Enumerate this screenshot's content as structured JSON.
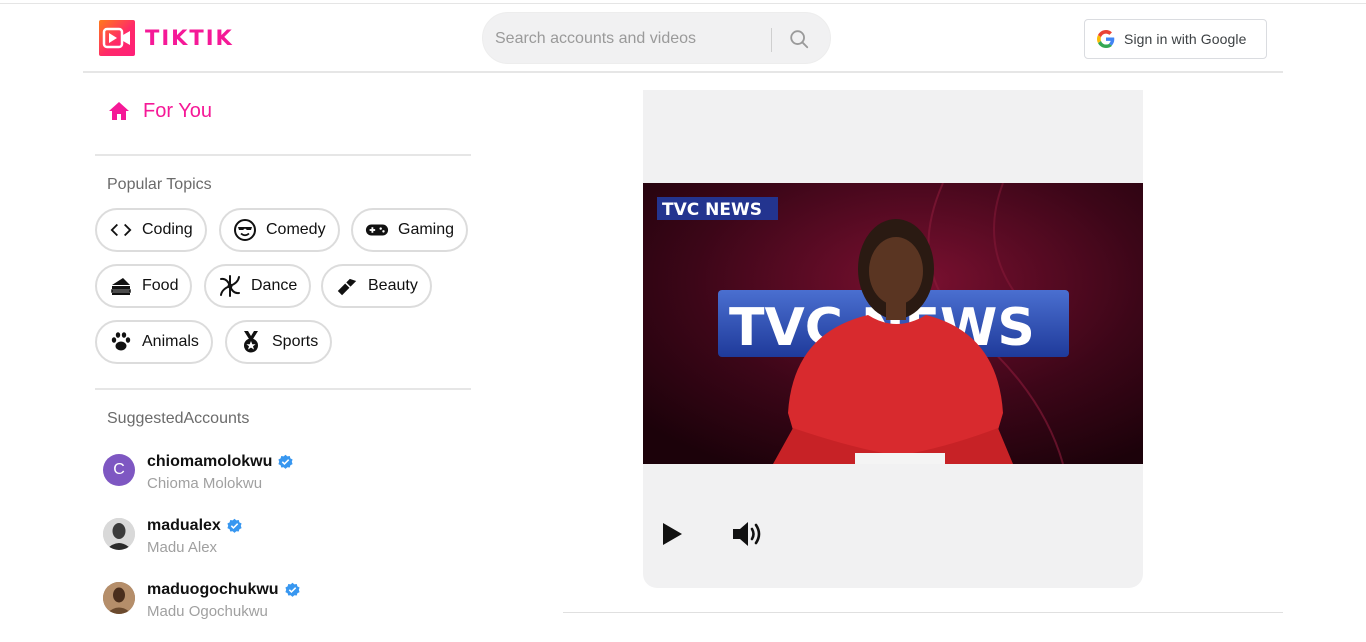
{
  "header": {
    "logo_text": "TIKTIK",
    "search": {
      "placeholder": "Search accounts and videos"
    },
    "signin_label": "Sign in with Google"
  },
  "sidebar": {
    "for_you_label": "For You",
    "popular_topics_title": "Popular Topics",
    "topics": [
      {
        "label": "Coding",
        "icon": "code-icon"
      },
      {
        "label": "Comedy",
        "icon": "cool-face-icon"
      },
      {
        "label": "Gaming",
        "icon": "gamepad-icon"
      },
      {
        "label": "Food",
        "icon": "cake-icon"
      },
      {
        "label": "Dance",
        "icon": "dance-icon"
      },
      {
        "label": "Beauty",
        "icon": "lipstick-icon"
      },
      {
        "label": "Animals",
        "icon": "paw-icon"
      },
      {
        "label": "Sports",
        "icon": "medal-icon"
      }
    ],
    "suggested_title": "SuggestedAccounts",
    "accounts": [
      {
        "username": "chiomamolokwu",
        "name": "Chioma Molokwu",
        "avatar_letter": "C",
        "avatar_color": "#7e57c2"
      },
      {
        "username": "madualex",
        "name": "Madu Alex"
      },
      {
        "username": "maduogochukwu",
        "name": "Madu Ogochukwu"
      }
    ]
  },
  "video": {
    "channel_badge": "TVC NEWS",
    "backdrop_text": "TVC NEWS",
    "controls": [
      "play-icon",
      "volume-icon"
    ]
  },
  "colors": {
    "brand": "#f51997",
    "verified": "#3897f0"
  }
}
